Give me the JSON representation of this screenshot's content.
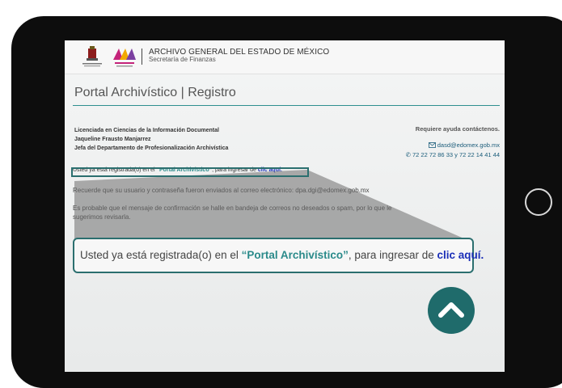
{
  "header": {
    "org_title": "ARCHIVO GENERAL DEL ESTADO DE MÉXICO",
    "org_subtitle": "Secretaría de Finanzas",
    "logo_left_text": "GOBIERNO DEL ESTADO DE MÉXICO",
    "logo_right_text": "EDOMÉX"
  },
  "page": {
    "title": "Portal Archivístico | Registro"
  },
  "contact_person": {
    "line1": "Licenciada en Ciencias de la Información Documental",
    "line2": "Jaqueline Frausto Manjarrez",
    "line3": "Jefa del Departamento de Profesionalización Archivística"
  },
  "help": {
    "title": "Requiere ayuda contáctenos.",
    "email": "dasd@edomex.gob.mx",
    "phone": "72 22 72 86 33 y 72 22 14 41 44"
  },
  "messages": {
    "registered_prefix": "Usted ya está registrada(o) en el ",
    "portal_name": "“Portal Archivístico”",
    "registered_mid": ", para ingresar de ",
    "link_text": "clic aquí.",
    "credentials": "Recuerde que su usuario y contraseña fueron enviados al correo electrónico: dpa.dgi@edomex.gob.mx",
    "spam_notice": "Es probable que el mensaje de confirmación se halle en bandeja de correos no deseados o spam, por lo que le sugerimos revisarla."
  },
  "colors": {
    "accent_teal": "#2a8a8a",
    "link_blue": "#1b2fb8",
    "button_dark_teal": "#1f6b6b"
  },
  "icons": {
    "email": "envelope-icon",
    "phone": "phone-icon",
    "scroll_up": "chevron-up-icon"
  }
}
